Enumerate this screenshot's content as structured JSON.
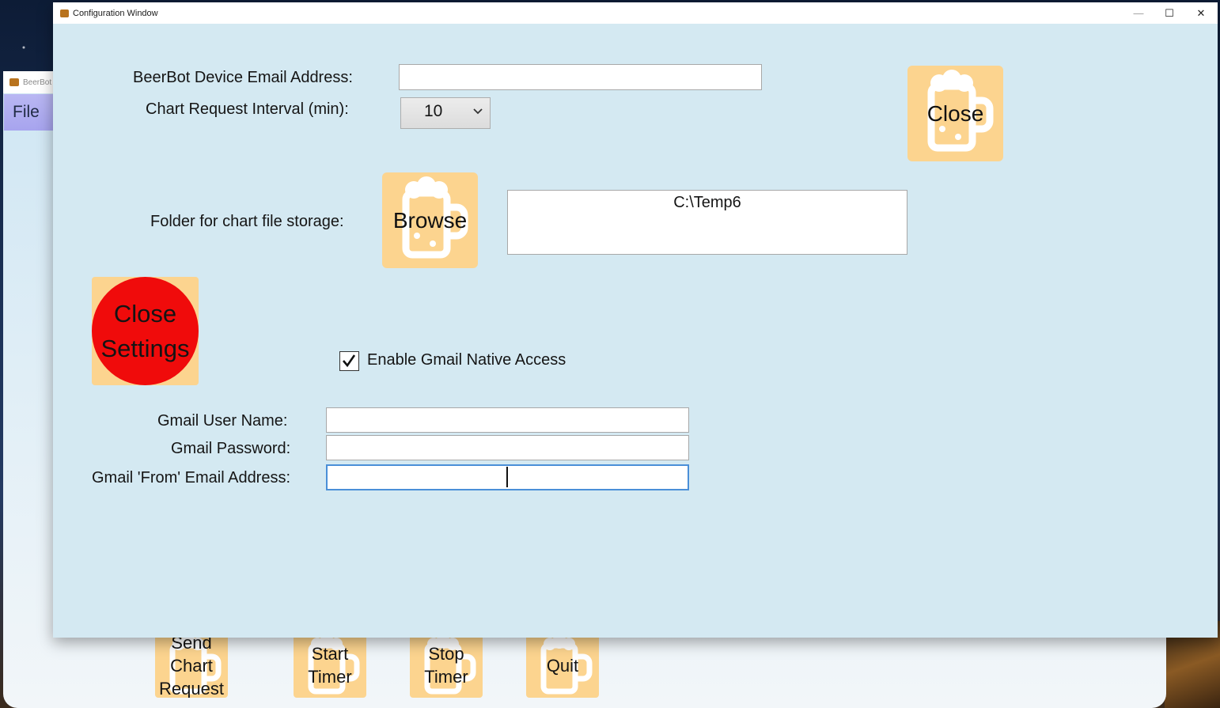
{
  "background_window": {
    "title": "BeerBot V",
    "menu": {
      "file_label": "File"
    },
    "buttons": [
      {
        "label": "Send\nChart\nRequest"
      },
      {
        "label": "Start\nTimer"
      },
      {
        "label": "Stop\nTimer"
      },
      {
        "label": "Quit"
      }
    ]
  },
  "config_window": {
    "title": "Configuration Window",
    "controls": {
      "minimize": "—",
      "maximize": "☐",
      "close": "✕"
    },
    "device_email": {
      "label": "BeerBot Device Email Address:",
      "value": ""
    },
    "chart_interval": {
      "label": "Chart Request Interval (min):",
      "value": "10"
    },
    "close_button": {
      "label": "Close"
    },
    "folder": {
      "label": "Folder for chart file storage:",
      "browse_label": "Browse",
      "path": "C:\\Temp6"
    },
    "close_settings_button": {
      "label": "Close\nSettings"
    },
    "gmail_native": {
      "label": "Enable Gmail Native Access",
      "checked": true
    },
    "gmail_user": {
      "label": "Gmail User Name:",
      "value": ""
    },
    "gmail_password": {
      "label": "Gmail Password:",
      "value": ""
    },
    "gmail_from": {
      "label": "Gmail 'From' Email Address:",
      "value": ""
    }
  },
  "colors": {
    "config_bg": "#d4e9f2",
    "mug_button_bg": "#fcd48f",
    "close_settings_red": "#f00b0b",
    "focus_border": "#4a8fd8",
    "file_menu_bg": "#b9b7f3"
  }
}
